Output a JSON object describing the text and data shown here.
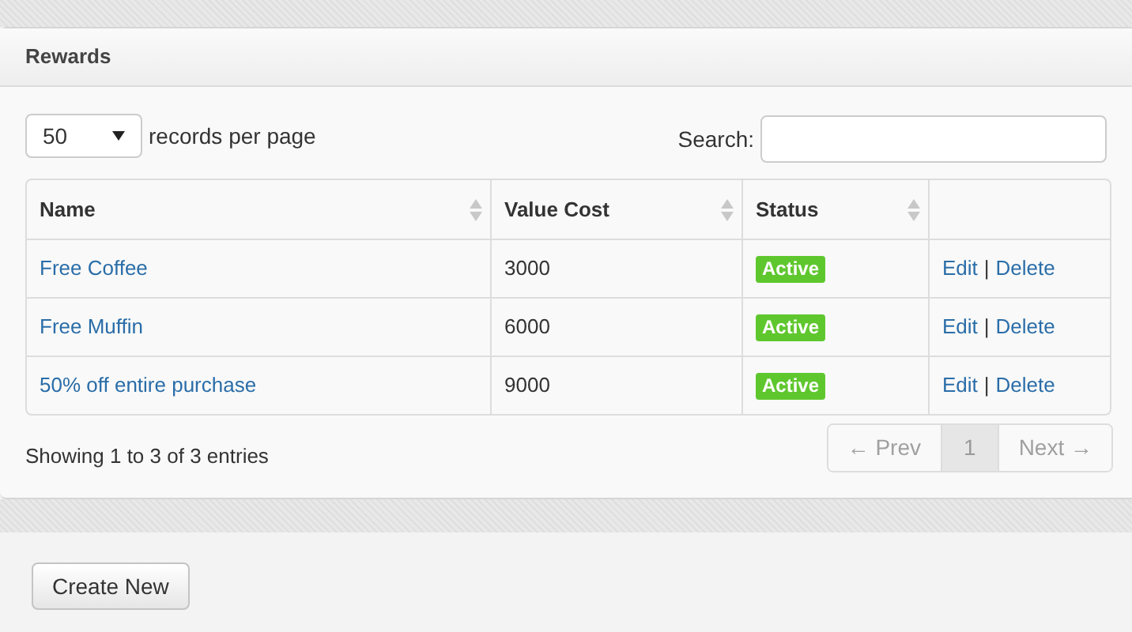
{
  "panel": {
    "title": "Rewards"
  },
  "length_menu": {
    "value": "50",
    "label": "records per page"
  },
  "search": {
    "label": "Search:"
  },
  "table": {
    "columns": [
      {
        "label": "Name",
        "sortable": true
      },
      {
        "label": "Value Cost",
        "sortable": true
      },
      {
        "label": "Status",
        "sortable": true
      },
      {
        "sortable": false
      }
    ],
    "rows": [
      {
        "name": "Free Coffee",
        "value_cost": "3000",
        "status": "Active",
        "actions": [
          "Edit",
          "|",
          "Delete"
        ]
      },
      {
        "name": "Free Muffin",
        "value_cost": "6000",
        "status": "Active",
        "actions": [
          "Edit",
          "|",
          "Delete"
        ]
      },
      {
        "name": "50% off entire purchase",
        "value_cost": "9000",
        "status": "Active",
        "actions": [
          "Edit",
          "|",
          "Delete"
        ]
      }
    ]
  },
  "info": "Showing 1 to 3 of 3 entries",
  "pagination": [
    {
      "kind": "prev",
      "label": "← Prev",
      "disabled": true,
      "selected": false
    },
    {
      "kind": "page",
      "label": "1",
      "disabled": false,
      "selected": true
    },
    {
      "kind": "next",
      "label": "Next →",
      "disabled": true,
      "selected": false
    }
  ],
  "create_button": "Create New"
}
